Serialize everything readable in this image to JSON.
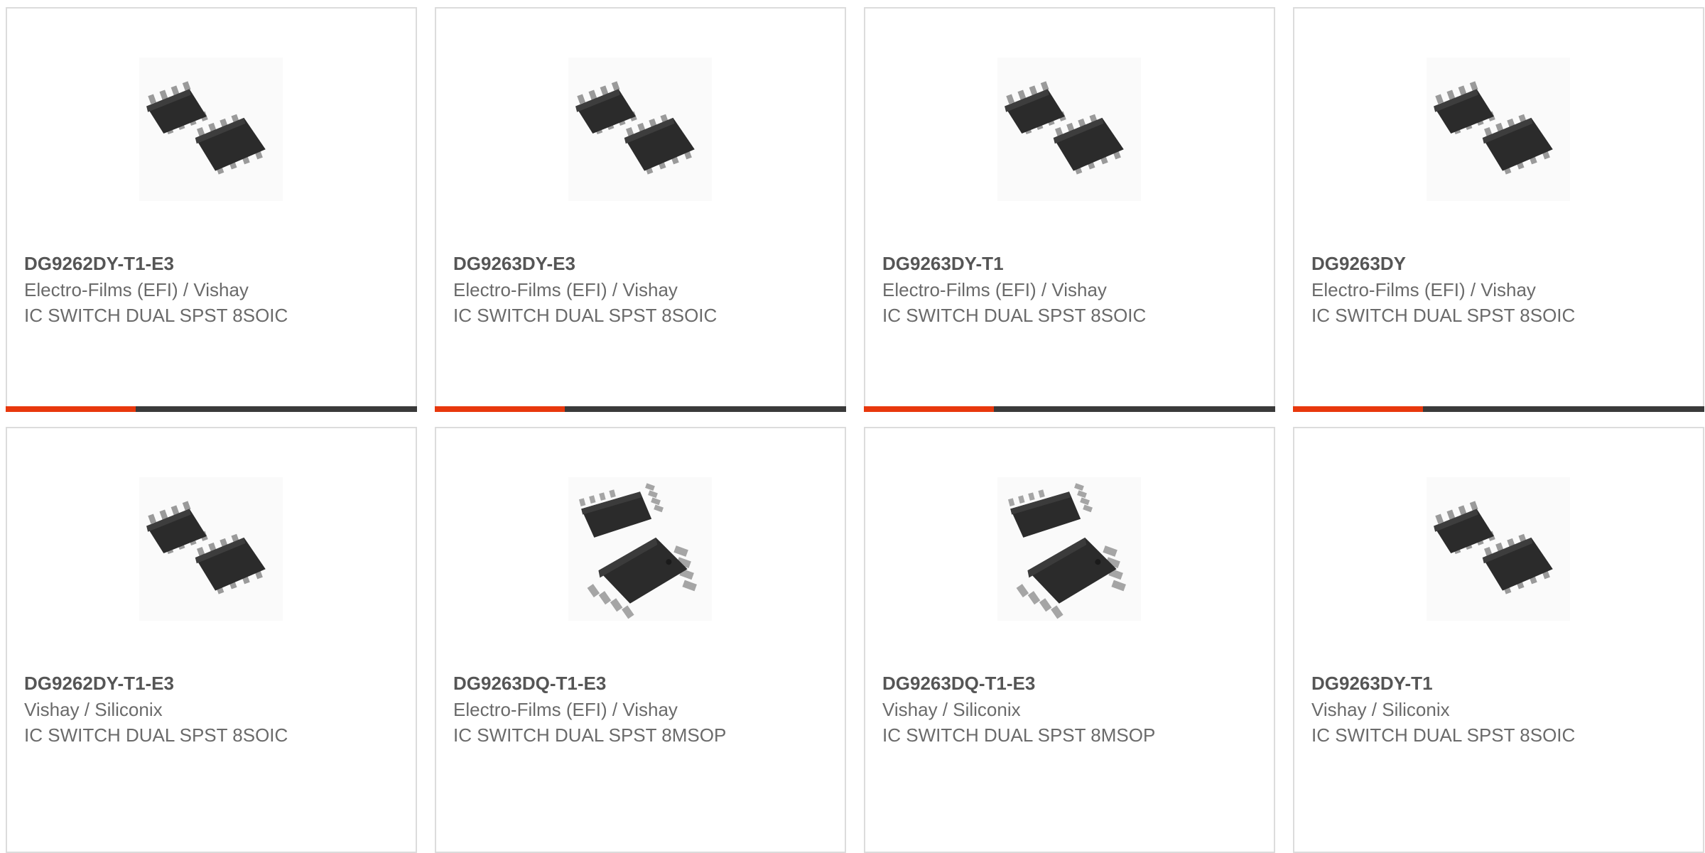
{
  "accent_color": "#e8380d",
  "bar_color": "#3a3a3a",
  "products": [
    {
      "part": "DG9262DY-T1-E3",
      "manufacturer": "Electro-Films (EFI) / Vishay",
      "description": "IC SWITCH DUAL SPST 8SOIC",
      "image": "soic-8-package-icon",
      "accent_bar": true
    },
    {
      "part": "DG9263DY-E3",
      "manufacturer": "Electro-Films (EFI) / Vishay",
      "description": "IC SWITCH DUAL SPST 8SOIC",
      "image": "soic-8-package-icon",
      "accent_bar": true
    },
    {
      "part": "DG9263DY-T1",
      "manufacturer": "Electro-Films (EFI) / Vishay",
      "description": "IC SWITCH DUAL SPST 8SOIC",
      "image": "soic-8-package-icon",
      "accent_bar": true
    },
    {
      "part": "DG9263DY",
      "manufacturer": "Electro-Films (EFI) / Vishay",
      "description": "IC SWITCH DUAL SPST 8SOIC",
      "image": "soic-8-package-icon",
      "accent_bar": true
    },
    {
      "part": "DG9262DY-T1-E3",
      "manufacturer": "Vishay / Siliconix",
      "description": "IC SWITCH DUAL SPST 8SOIC",
      "image": "soic-8-package-icon",
      "accent_bar": false
    },
    {
      "part": "DG9263DQ-T1-E3",
      "manufacturer": "Electro-Films (EFI) / Vishay",
      "description": "IC SWITCH DUAL SPST 8MSOP",
      "image": "msop-8-package-icon",
      "accent_bar": false
    },
    {
      "part": "DG9263DQ-T1-E3",
      "manufacturer": "Vishay / Siliconix",
      "description": "IC SWITCH DUAL SPST 8MSOP",
      "image": "msop-8-package-icon",
      "accent_bar": false
    },
    {
      "part": "DG9263DY-T1",
      "manufacturer": "Vishay / Siliconix",
      "description": "IC SWITCH DUAL SPST 8SOIC",
      "image": "soic-8-package-icon",
      "accent_bar": false
    }
  ]
}
